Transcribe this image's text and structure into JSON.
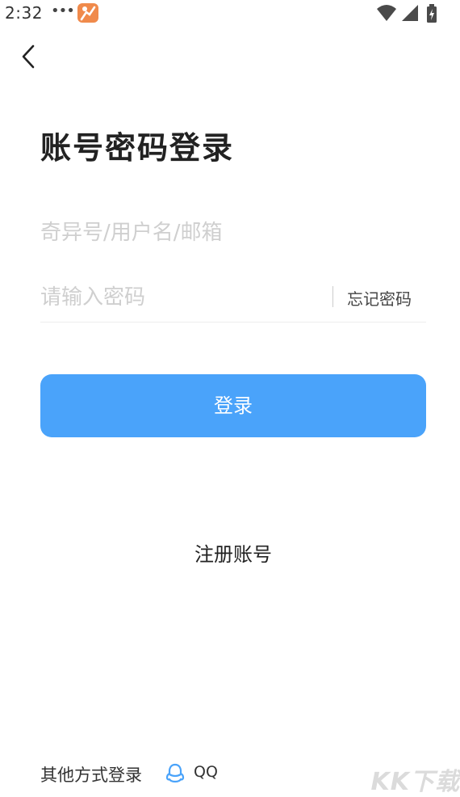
{
  "status_bar": {
    "time": "2:32",
    "dots": "•••",
    "icons": [
      "app-icon",
      "wifi-icon",
      "signal-icon",
      "battery-icon"
    ]
  },
  "header": {
    "back_icon": "chevron-left-icon"
  },
  "title": "账号密码登录",
  "form": {
    "username_placeholder": "奇异号/用户名/邮箱",
    "password_placeholder": "请输入密码",
    "forgot_label": "忘记密码",
    "login_label": "登录"
  },
  "register_label": "注册账号",
  "other_login": {
    "label": "其他方式登录",
    "qq_label": "QQ",
    "qq_icon": "qq-icon"
  },
  "watermark": "KK下载",
  "colors": {
    "primary_button": "#4aa3fa",
    "qq_icon": "#4aa3fa",
    "app_icon": "#f08a4b"
  }
}
